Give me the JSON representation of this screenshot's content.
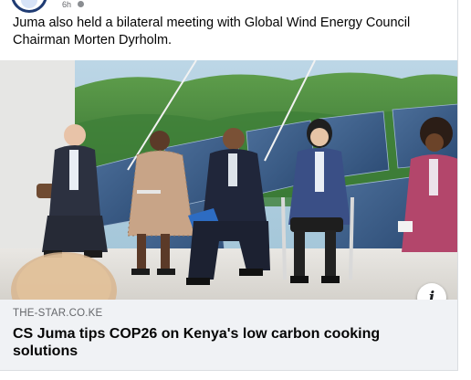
{
  "post": {
    "meta_text": "6h",
    "caption": "Juma also held a bilateral meeting with Global Wind Energy Council Chairman Morten Dyrholm."
  },
  "link_preview": {
    "domain": "THE-STAR.CO.KE",
    "headline": "CS Juma tips COP26 on Kenya's low carbon cooking solutions",
    "info_icon": "i"
  },
  "photo": {
    "description_icon": "photo"
  },
  "colors": {
    "text": "#050505",
    "secondary_text": "#65676b",
    "link_box_bg": "#f0f2f5"
  }
}
